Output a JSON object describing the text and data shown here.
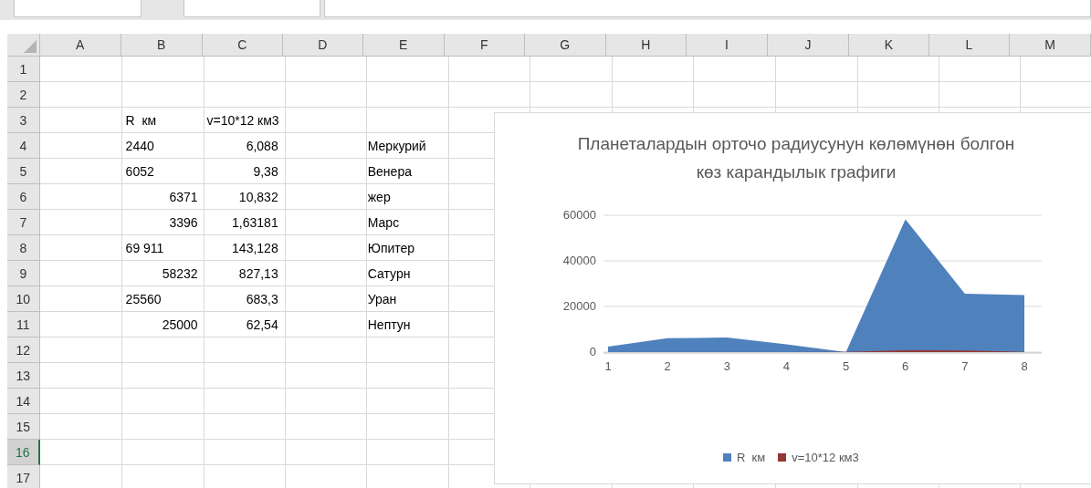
{
  "sheet": {
    "columns": [
      "A",
      "B",
      "C",
      "D",
      "E",
      "F",
      "G",
      "H",
      "I",
      "J",
      "K",
      "L",
      "M"
    ],
    "rows": [
      {
        "number": "1",
        "selected": false,
        "cells": {}
      },
      {
        "number": "2",
        "selected": false,
        "cells": {}
      },
      {
        "number": "3",
        "selected": false,
        "cells": {
          "B": {
            "text": "R  км",
            "kind": "text"
          },
          "C": {
            "text": "v=10*12 км3",
            "kind": "text"
          }
        }
      },
      {
        "number": "4",
        "selected": false,
        "cells": {
          "B": {
            "text": "2440",
            "kind": "text"
          },
          "C": {
            "text": "6,088",
            "kind": "number"
          },
          "E": {
            "text": "Меркурий",
            "kind": "text"
          }
        }
      },
      {
        "number": "5",
        "selected": false,
        "cells": {
          "B": {
            "text": "6052",
            "kind": "text"
          },
          "C": {
            "text": "9,38",
            "kind": "number"
          },
          "E": {
            "text": "Венера",
            "kind": "text"
          }
        }
      },
      {
        "number": "6",
        "selected": false,
        "cells": {
          "B": {
            "text": "6371",
            "kind": "number"
          },
          "C": {
            "text": "10,832",
            "kind": "number"
          },
          "E": {
            "text": "жер",
            "kind": "text"
          }
        }
      },
      {
        "number": "7",
        "selected": false,
        "cells": {
          "B": {
            "text": "3396",
            "kind": "number"
          },
          "C": {
            "text": "1,63181",
            "kind": "number"
          },
          "E": {
            "text": "Марс",
            "kind": "text"
          }
        }
      },
      {
        "number": "8",
        "selected": false,
        "cells": {
          "B": {
            "text": "69 911",
            "kind": "text"
          },
          "C": {
            "text": "143,128",
            "kind": "number"
          },
          "E": {
            "text": "Юпитер",
            "kind": "text"
          }
        }
      },
      {
        "number": "9",
        "selected": false,
        "cells": {
          "B": {
            "text": "58232",
            "kind": "number"
          },
          "C": {
            "text": "827,13",
            "kind": "number"
          },
          "E": {
            "text": "Сатурн",
            "kind": "text"
          }
        }
      },
      {
        "number": "10",
        "selected": false,
        "cells": {
          "B": {
            "text": "25560",
            "kind": "text"
          },
          "C": {
            "text": "683,3",
            "kind": "number"
          },
          "E": {
            "text": "Уран",
            "kind": "text"
          }
        }
      },
      {
        "number": "11",
        "selected": false,
        "cells": {
          "B": {
            "text": "25000",
            "kind": "number"
          },
          "C": {
            "text": "62,54",
            "kind": "number"
          },
          "E": {
            "text": "Нептун",
            "kind": "text"
          }
        }
      },
      {
        "number": "12",
        "selected": false,
        "cells": {}
      },
      {
        "number": "13",
        "selected": false,
        "cells": {}
      },
      {
        "number": "14",
        "selected": false,
        "cells": {}
      },
      {
        "number": "15",
        "selected": false,
        "cells": {}
      },
      {
        "number": "16",
        "selected": true,
        "cells": {}
      },
      {
        "number": "17",
        "selected": false,
        "cells": {}
      }
    ]
  },
  "chart": {
    "chart_data": {
      "type": "area",
      "title": "Планеталардын орточо радиусунун көлөмүнөн болгон көз карандылык графиги",
      "categories": [
        "1",
        "2",
        "3",
        "4",
        "5",
        "6",
        "7",
        "8"
      ],
      "yticks": [
        0,
        20000,
        40000,
        60000
      ],
      "ylim": [
        0,
        60000
      ],
      "legend": "bottom",
      "series": [
        {
          "name": "R  км",
          "color": "#4f81bd",
          "values": [
            2440,
            6052,
            6371,
            3396,
            0,
            58232,
            25560,
            25000
          ]
        },
        {
          "name": "v=10*12 км3",
          "color": "#953735",
          "values": [
            6.088,
            9.38,
            10.832,
            1.63181,
            143.128,
            827.13,
            683.3,
            62.54
          ]
        }
      ]
    }
  }
}
